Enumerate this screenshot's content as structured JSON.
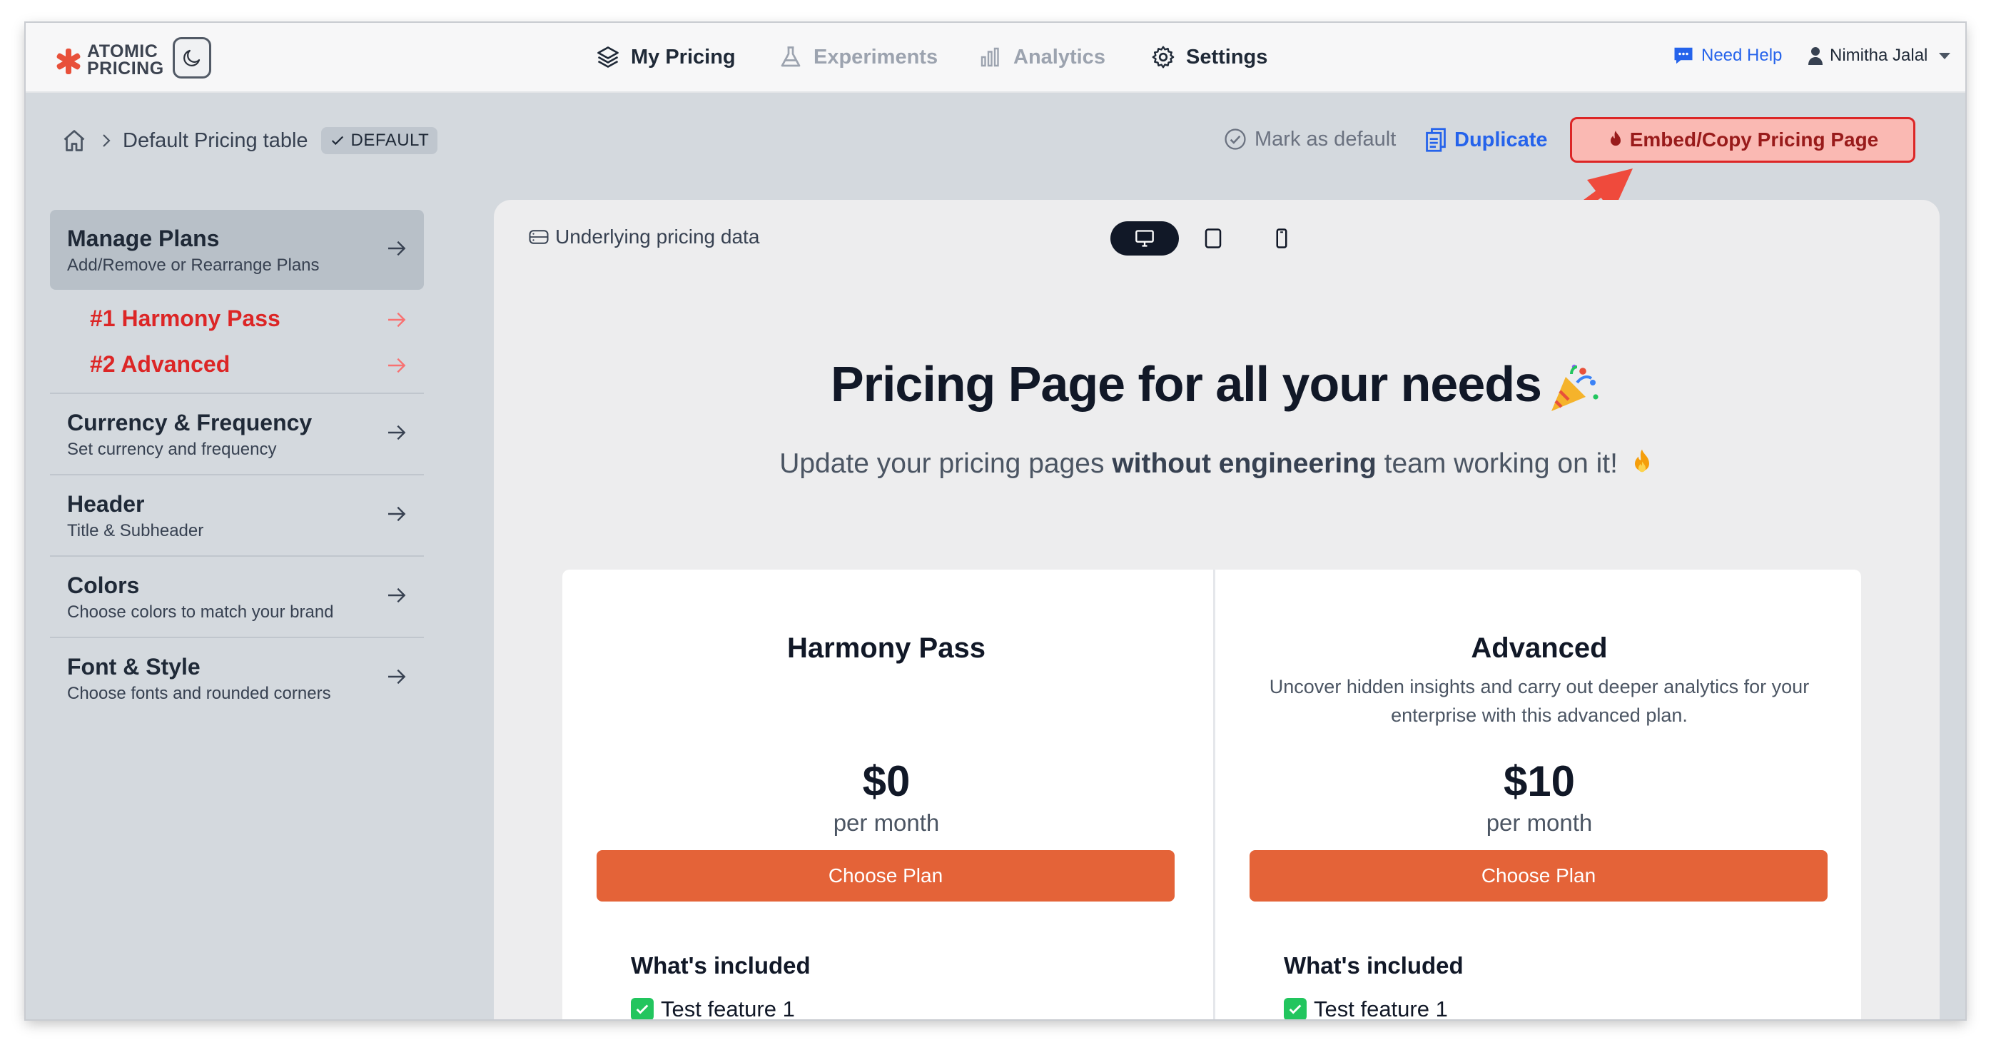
{
  "app": {
    "logo_text_line1": "ATOMIC",
    "logo_text_line2": "PRICING"
  },
  "nav": {
    "my_pricing": "My Pricing",
    "experiments": "Experiments",
    "analytics": "Analytics",
    "settings": "Settings",
    "need_help": "Need Help",
    "user_name": "Nimitha Jalal"
  },
  "breadcrumb": {
    "title": "Default Pricing table",
    "badge": "DEFAULT"
  },
  "actions": {
    "mark_default": "Mark as default",
    "duplicate": "Duplicate",
    "embed": "Embed/Copy Pricing Page"
  },
  "sidebar": {
    "items": [
      {
        "title": "Manage Plans",
        "subtitle": "Add/Remove or Rearrange Plans"
      },
      {
        "title": "Currency & Frequency",
        "subtitle": "Set currency and frequency"
      },
      {
        "title": "Header",
        "subtitle": "Title & Subheader"
      },
      {
        "title": "Colors",
        "subtitle": "Choose colors to match your brand"
      },
      {
        "title": "Font & Style",
        "subtitle": "Choose fonts and rounded corners"
      }
    ],
    "plans": [
      "#1 Harmony Pass",
      "#2 Advanced"
    ]
  },
  "preview": {
    "underlying": "Underlying pricing data",
    "title": "Pricing Page for all your needs",
    "subtitle_pre": "Update your pricing pages ",
    "subtitle_bold": "without engineering",
    "subtitle_post": " team working on it!",
    "plans": [
      {
        "name": "Harmony Pass",
        "description": "",
        "price": "$0",
        "period": "per month",
        "cta": "Choose Plan",
        "included_label": "What's included",
        "feature": "Test feature 1"
      },
      {
        "name": "Advanced",
        "description": "Uncover hidden insights and carry out deeper analytics for your enterprise with this advanced plan.",
        "price": "$10",
        "period": "per month",
        "cta": "Choose Plan",
        "included_label": "What's included",
        "feature": "Test feature 1"
      }
    ]
  },
  "colors": {
    "accent": "#e46338",
    "danger": "#dc2626",
    "link": "#2563eb"
  }
}
